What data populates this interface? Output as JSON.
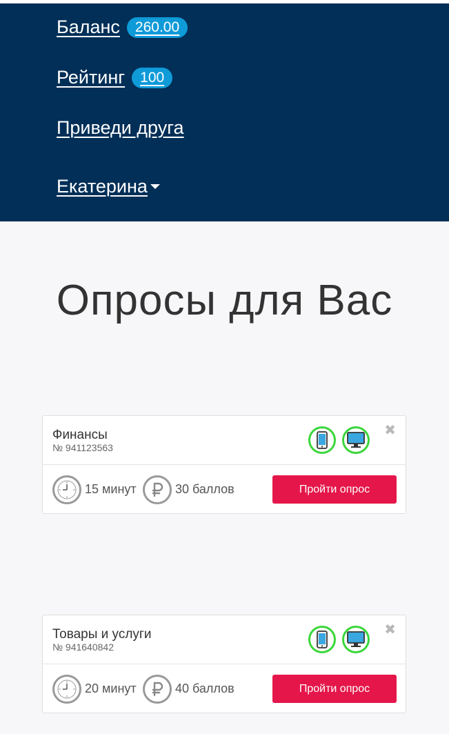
{
  "nav": {
    "balance_label": "Баланс",
    "balance_value": "260.00",
    "rating_label": "Рейтинг",
    "rating_value": "100",
    "invite_label": "Приведи друга",
    "user_name": "Екатерина"
  },
  "page_title": "Опросы для Вас",
  "surveys": [
    {
      "title": "Финансы",
      "number": "№ 941123563",
      "duration": "15 минут",
      "points": "30 баллов",
      "cta": "Пройти опрос",
      "devices": [
        "smartphone-icon",
        "desktop-icon"
      ]
    },
    {
      "title": "Товары и услуги",
      "number": "№ 941640842",
      "duration": "20 минут",
      "points": "40 баллов",
      "cta": "Пройти опрос",
      "devices": [
        "smartphone-icon",
        "desktop-icon"
      ]
    }
  ],
  "colors": {
    "header_bg": "#012f57",
    "badge": "#0f9ad8",
    "device_ring": "#3ad63a",
    "cta": "#e5174a"
  }
}
